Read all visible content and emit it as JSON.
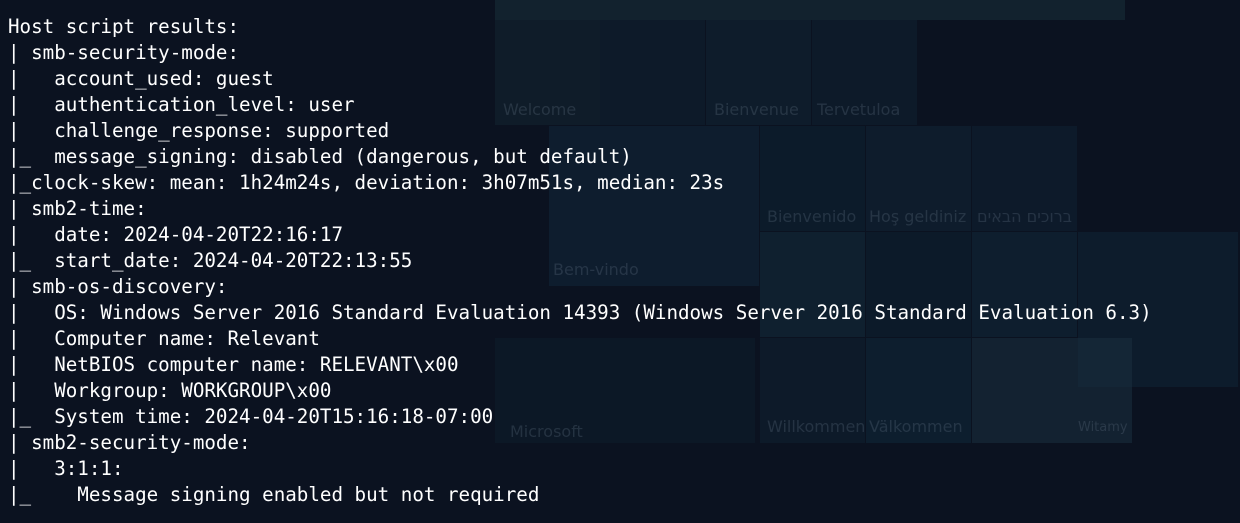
{
  "terminal": {
    "lines": [
      "Host script results:",
      "| smb-security-mode:",
      "|   account_used: guest",
      "|   authentication_level: user",
      "|   challenge_response: supported",
      "|_  message_signing: disabled (dangerous, but default)",
      "|_clock-skew: mean: 1h24m24s, deviation: 3h07m51s, median: 23s",
      "| smb2-time:",
      "|   date: 2024-04-20T22:16:17",
      "|_  start_date: 2024-04-20T22:13:55",
      "| smb-os-discovery:",
      "|   OS: Windows Server 2016 Standard Evaluation 14393 (Windows Server 2016 Standard Evaluation 6.3)",
      "|   Computer name: Relevant",
      "|   NetBIOS computer name: RELEVANT\\x00",
      "|   Workgroup: WORKGROUP\\x00",
      "|_  System time: 2024-04-20T15:16:18-07:00",
      "| smb2-security-mode:",
      "|   3:1:1:",
      "|_    Message signing enabled but not required"
    ]
  },
  "background": {
    "words": [
      "Welcome",
      "Bienvenue",
      "Tervetuloa",
      "Bienvenido",
      "Hoş geldiniz",
      "ברוכים הבאים",
      "Bem-vindo",
      "Microsoft",
      "Willkommen",
      "Välkommen",
      "Witamy"
    ]
  },
  "colors": {
    "background": "#0b1220",
    "text": "#ffffff"
  }
}
